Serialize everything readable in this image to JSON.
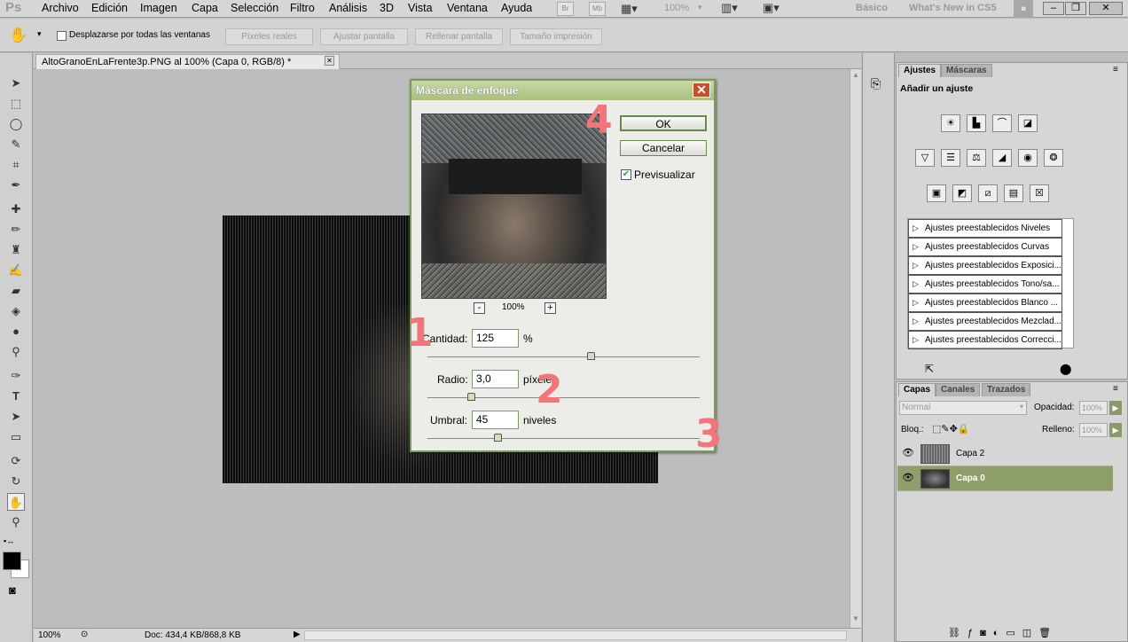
{
  "menubar": {
    "logo": "Ps",
    "items": [
      "Archivo",
      "Edición",
      "Imagen",
      "Capa",
      "Selección",
      "Filtro",
      "Análisis",
      "3D",
      "Vista",
      "Ventana",
      "Ayuda"
    ],
    "br": "Br",
    "mb": "Mb",
    "zoom": "100%",
    "workspace_basic": "Básico",
    "workspace_new": "What's New in CS5"
  },
  "options": {
    "scroll_all": "Desplazarse por todas las ventanas",
    "btn_real": "Píxeles reales",
    "btn_fit": "Ajustar pantalla",
    "btn_fill": "Rellenar pantalla",
    "btn_print": "Tamaño impresión"
  },
  "document": {
    "tab_title": "AltoGranoEnLaFrente3p.PNG al 100% (Capa 0, RGB/8) *"
  },
  "status": {
    "zoom": "100%",
    "doc": "Doc: 434,4 KB/868,8 KB"
  },
  "adjust_panel": {
    "tab_adjust": "Ajustes",
    "tab_masks": "Máscaras",
    "heading": "Añadir un ajuste",
    "presets": [
      "Ajustes preestablecidos Niveles",
      "Ajustes preestablecidos Curvas",
      "Ajustes preestablecidos Exposici...",
      "Ajustes preestablecidos Tono/sa...",
      "Ajustes preestablecidos Blanco ...",
      "Ajustes preestablecidos Mezclad...",
      "Ajustes preestablecidos Correcci..."
    ]
  },
  "layers_panel": {
    "tab_layers": "Capas",
    "tab_channels": "Canales",
    "tab_paths": "Trazados",
    "blend_mode": "Normal",
    "opacity_label": "Opacidad:",
    "opacity_value": "100%",
    "lock_label": "Bloq.:",
    "fill_label": "Relleno:",
    "fill_value": "100%",
    "layers": [
      "Capa 2",
      "Capa 0"
    ]
  },
  "dialog": {
    "title": "Máscara de enfoque",
    "ok": "OK",
    "cancel": "Cancelar",
    "preview_label": "Previsualizar",
    "zoom": "100%",
    "amount_label": "Cantidad:",
    "amount_value": "125",
    "amount_unit": "%",
    "amount_fraction": 0.6,
    "radius_label": "Radio:",
    "radius_value": "3,0",
    "radius_unit": "píxeles",
    "radius_fraction": 0.15,
    "threshold_label": "Umbral:",
    "threshold_value": "45",
    "threshold_unit": "niveles",
    "threshold_fraction": 0.25
  },
  "annotations": [
    "1",
    "2",
    "3",
    "4"
  ],
  "colors": {
    "annotation": "#f2757a",
    "selected_layer": "#8e9f6c",
    "dialog_border": "#7a9a5c"
  }
}
